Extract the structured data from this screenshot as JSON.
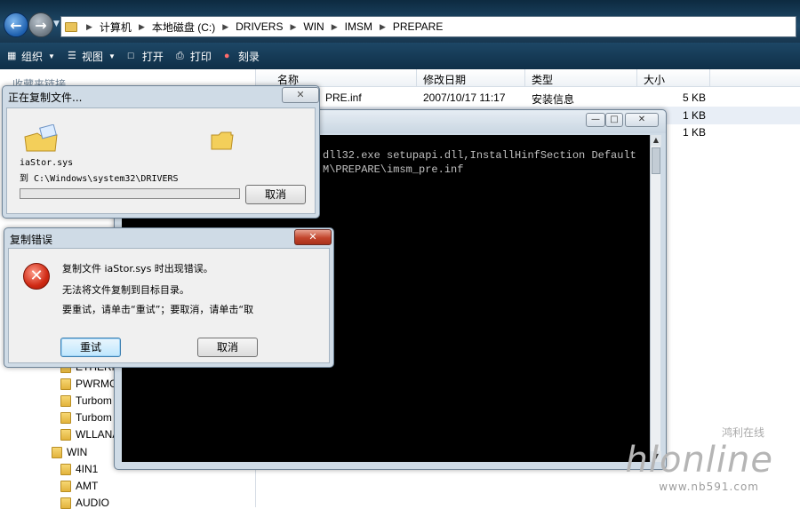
{
  "address_bar": {
    "crumbs": [
      "计算机",
      "本地磁盘 (C:)",
      "DRIVERS",
      "WIN",
      "IMSM",
      "PREPARE"
    ]
  },
  "toolbar": {
    "organize": "组织",
    "views": "视图",
    "open": "打开",
    "print": "打印",
    "burn": "刻录"
  },
  "left_pane": {
    "header_partial": "收藏夹链接",
    "tree": [
      "ETHERN",
      "PWRMG",
      "Turbom",
      "Turbom",
      "WLLANA",
      "WIN",
      "4IN1",
      "AMT",
      "AUDIO"
    ]
  },
  "file_list": {
    "columns": [
      "名称",
      "修改日期",
      "类型",
      "大小"
    ],
    "rows": [
      {
        "name": "PRE.inf",
        "date": "2007/10/17 11:17",
        "type": "安装信息",
        "size": "5 KB"
      },
      {
        "name": "",
        "date": "",
        "type": "",
        "size": "1 KB"
      },
      {
        "name": "",
        "date": "",
        "type": "",
        "size": "1 KB"
      }
    ]
  },
  "cmd": {
    "lines": [
      "dll32.exe setupapi.dll,InstallHinfSection Default",
      "M\\PREPARE\\imsm_pre.inf"
    ]
  },
  "copy_dialog": {
    "title": "正在复制文件...",
    "filename": "iaStor.sys",
    "destination": "到 C:\\Windows\\system32\\DRIVERS",
    "cancel": "取消",
    "progress": 0.0
  },
  "error_dialog": {
    "title": "复制错误",
    "line1": "复制文件 iaStor.sys 时出现错误。",
    "line2": "无法将文件复制到目标目录。",
    "line3": "要重试，请单击“重试”；要取消，请单击“取",
    "retry": "重试",
    "cancel": "取消"
  },
  "watermark": {
    "script_cn": "鸿利在线",
    "logo": "hlonline",
    "url": "www.nb591.com"
  }
}
